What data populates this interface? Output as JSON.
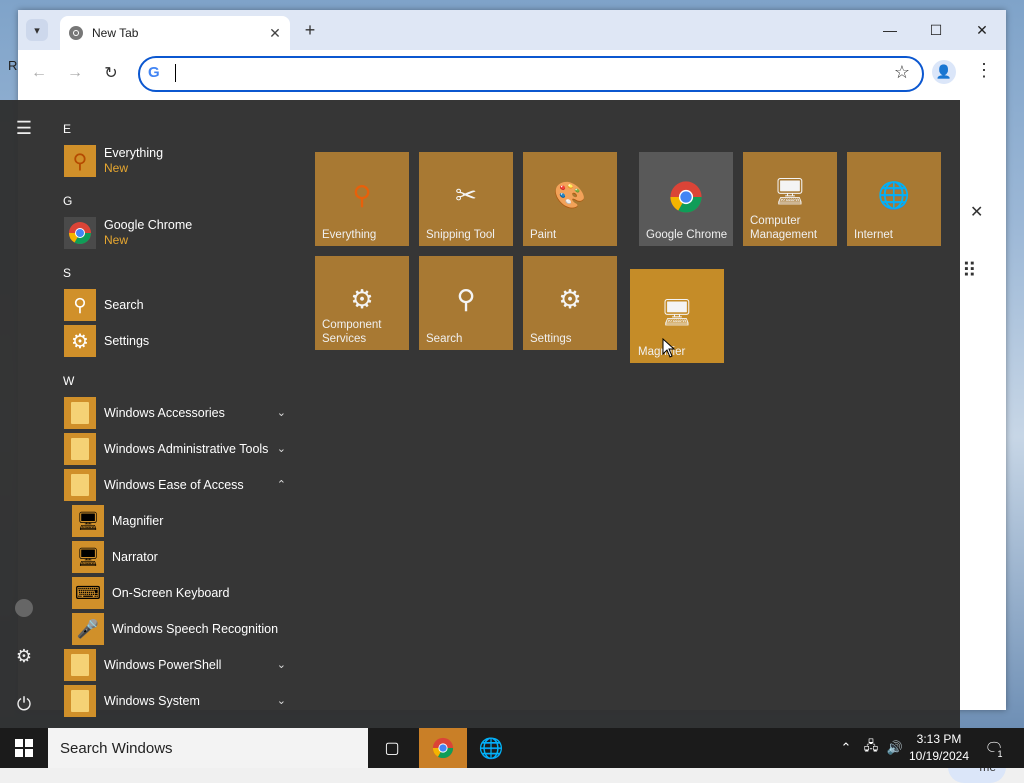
{
  "desktop": {
    "edge_text": "R"
  },
  "browser": {
    "tab_title": "New Tab",
    "omnibox_value": "",
    "side_pill_text": "me"
  },
  "start_menu": {
    "sections": [
      {
        "letter": "E",
        "items": [
          {
            "label": "Everything",
            "badge": "New"
          }
        ]
      },
      {
        "letter": "G",
        "items": [
          {
            "label": "Google Chrome",
            "badge": "New"
          }
        ]
      },
      {
        "letter": "S",
        "items": [
          {
            "label": "Search"
          },
          {
            "label": "Settings"
          }
        ]
      },
      {
        "letter": "W",
        "items": [
          {
            "label": "Windows Accessories",
            "expand": "down"
          },
          {
            "label": "Windows Administrative Tools",
            "expand": "down"
          },
          {
            "label": "Windows Ease of Access",
            "expand": "up"
          },
          {
            "label": "Magnifier"
          },
          {
            "label": "Narrator"
          },
          {
            "label": "On-Screen Keyboard"
          },
          {
            "label": "Windows Speech Recognition"
          },
          {
            "label": "Windows PowerShell",
            "expand": "down"
          },
          {
            "label": "Windows System",
            "expand": "down"
          }
        ]
      }
    ],
    "tiles": [
      {
        "label": "Everything",
        "icon": "magnifier-orange-icon"
      },
      {
        "label": "Snipping Tool",
        "icon": "scissors-icon"
      },
      {
        "label": "Paint",
        "icon": "palette-icon"
      },
      {
        "label": "Google Chrome",
        "icon": "chrome-icon"
      },
      {
        "label": "Computer Management",
        "icon": "computer-management-icon"
      },
      {
        "label": "Internet",
        "icon": "globe-icon"
      },
      {
        "label": "Component Services",
        "icon": "component-services-icon"
      },
      {
        "label": "Search",
        "icon": "search-icon"
      },
      {
        "label": "Settings",
        "icon": "gear-icon"
      },
      {
        "label": "Magnifier",
        "icon": "magnifier-icon"
      }
    ]
  },
  "taskbar": {
    "search_placeholder": "Search Windows",
    "time": "3:13 PM",
    "date": "10/19/2024",
    "notification_count": "1"
  }
}
